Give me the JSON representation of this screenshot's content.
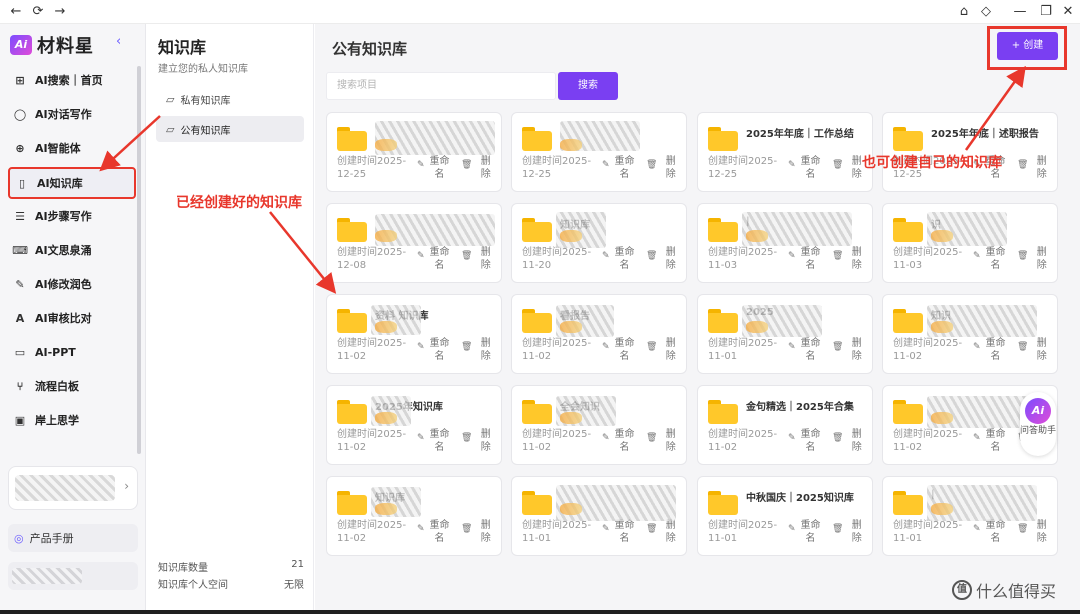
{
  "window": {
    "nav_back": "←",
    "nav_refresh": "⟳",
    "nav_forward": "→",
    "controls": [
      "⌂",
      "◇",
      "—",
      "❐",
      "✕"
    ]
  },
  "brand": {
    "badge": "Ai",
    "name": "材料星",
    "collapse": "‹"
  },
  "nav": {
    "items": [
      {
        "label": "AI搜索｜首页",
        "icon": "⊞"
      },
      {
        "label": "AI对话写作",
        "icon": "◯"
      },
      {
        "label": "AI智能体",
        "icon": "⊕"
      },
      {
        "label": "AI知识库",
        "icon": "▯"
      },
      {
        "label": "AI步骤写作",
        "icon": "☰"
      },
      {
        "label": "AI文思泉涌",
        "icon": "⌨"
      },
      {
        "label": "AI修改润色",
        "icon": "✎"
      },
      {
        "label": "AI审核比对",
        "icon": "A"
      },
      {
        "label": "AI-PPT",
        "icon": "▭"
      },
      {
        "label": "流程白板",
        "icon": "⑂"
      },
      {
        "label": "岸上思学",
        "icon": "▣"
      }
    ],
    "user_chevron": "›",
    "manual": "产品手册"
  },
  "kb": {
    "title": "知识库",
    "subtitle": "建立您的私人知识库",
    "items": [
      "私有知识库",
      "公有知识库"
    ],
    "count_label": "知识库数量",
    "count_value": "21",
    "space_label": "知识库个人空间",
    "space_value": "无限"
  },
  "main": {
    "title": "公有知识库",
    "create": "+ 创建",
    "search_placeholder": "搜索项目",
    "search_button": "搜索",
    "rename": "重命名",
    "delete": "删除",
    "cards": [
      {
        "title": "",
        "date": "创建时间2025-12-25"
      },
      {
        "title": "",
        "date": "创建时间2025-12-25"
      },
      {
        "title": "2025年年底｜工作总结",
        "date": "创建时间2025-12-25"
      },
      {
        "title": "2025年年底｜述职报告",
        "date": "创建时间2025-12-25"
      },
      {
        "title": "",
        "date": "创建时间2025-12-08"
      },
      {
        "title": "知识库",
        "date": "创建时间2025-11-20"
      },
      {
        "title": "|",
        "date": "创建时间2025-11-03"
      },
      {
        "title": "识",
        "date": "创建时间2025-11-03"
      },
      {
        "title": "资料 知识库",
        "date": "创建时间2025-11-02"
      },
      {
        "title": "看报告",
        "date": "创建时间2025-11-02"
      },
      {
        "title": "2025",
        "date": "创建时间2025-11-01"
      },
      {
        "title": "知识",
        "date": "创建时间2025-11-02"
      },
      {
        "title": "2025年知识库",
        "date": "创建时间2025-11-02"
      },
      {
        "title": "全会知识",
        "date": "创建时间2025-11-02"
      },
      {
        "title": "金句精选｜2025年合集",
        "date": "创建时间2025-11-02"
      },
      {
        "title": "",
        "date": "创建时间2025-11-02"
      },
      {
        "title": "知识库",
        "date": "创建时间2025-11-02"
      },
      {
        "title": "",
        "date": "创建时间2025-11-01"
      },
      {
        "title": "中秋国庆｜2025知识库",
        "date": "创建时间2025-11-01"
      },
      {
        "title": "|",
        "date": "创建时间2025-11-01"
      }
    ]
  },
  "annotations": {
    "existing": "已经创建好的知识库",
    "create_own": "也可创建自己的知识库",
    "color": "#e8372c"
  },
  "assistant": {
    "badge": "Ai",
    "label": "问答助手"
  },
  "watermark": {
    "badge": "值",
    "text": "什么值得买"
  },
  "colors": {
    "accent": "#7a3ff2",
    "folder": "#ffc82a",
    "annotation": "#e8372c"
  }
}
